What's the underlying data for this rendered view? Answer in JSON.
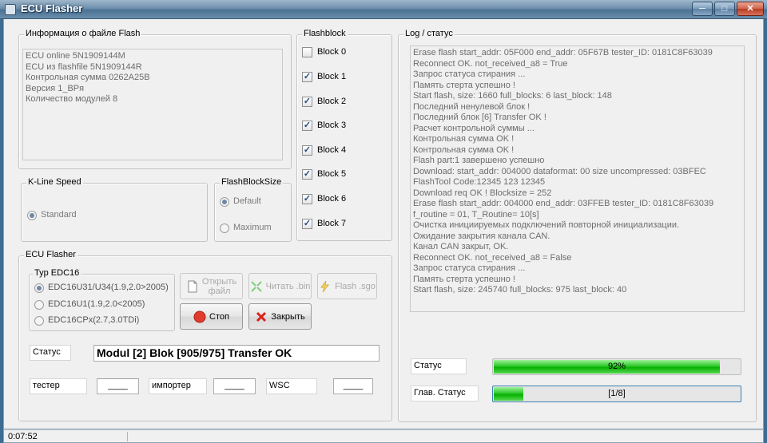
{
  "window": {
    "title": "ECU Flasher"
  },
  "file_info": {
    "legend": "Информация  о файле Flash",
    "lines": [
      "ECU online 5N1909144M",
      "ECU из flashfile 5N1909144R",
      "Контрольная сумма 0262A25B",
      "Версия 1_BPя",
      "Количество модулей 8"
    ]
  },
  "flashblock": {
    "legend": "Flashblock",
    "items": [
      {
        "label": "Block 0",
        "checked": false
      },
      {
        "label": "Block 1",
        "checked": true
      },
      {
        "label": "Block 2",
        "checked": true
      },
      {
        "label": "Block 3",
        "checked": true
      },
      {
        "label": "Block 4",
        "checked": true
      },
      {
        "label": "Block 5",
        "checked": true
      },
      {
        "label": "Block 6",
        "checked": true
      },
      {
        "label": "Block 7",
        "checked": true
      }
    ]
  },
  "kline": {
    "legend": "K-Line Speed",
    "option": "Standard"
  },
  "blocksize": {
    "legend": "FlashBlockSize",
    "default_label": "Default",
    "maximum_label": "Maximum"
  },
  "flasher": {
    "legend": "ECU Flasher",
    "edc": {
      "legend": "Typ EDC16",
      "options": [
        "EDC16U31/U34(1.9,2.0>2005)",
        "EDC16U1(1.9,2.0<2005)",
        "EDC16CPx(2.7,3.0TDi)"
      ]
    },
    "open_label": "Открыть\nфайл",
    "read_label": "Читать .bin",
    "flash_label": "Flash .sgo",
    "stop_label": "Стоп",
    "close_label": "Закрыть",
    "status_label": "Статус",
    "status_value": "Modul [2] Blok [905/975] Transfer OK",
    "tester_label": "тестер",
    "tester_value": "____",
    "importer_label": "импортер",
    "importer_value": "____",
    "wsc_label": "WSC",
    "wsc_value": "____"
  },
  "log": {
    "legend": "Log / статус",
    "lines": [
      "Erase flash start_addr: 05F000 end_addr: 05F67B tester_ID: 0181C8F63039",
      "Reconnect OK. not_received_a8 = True",
      "Запрос статуса стирания ...",
      "Память стерта успешно !",
      "Start flash, size: 1660 full_blocks: 6 last_block: 148",
      "Последний ненулевой блок !",
      "Последний блок [6] Transfer OK !",
      "Расчет контрольной суммы ...",
      "Контрольная сумма OK !",
      "Контрольная сумма OK !",
      "Flash part:1 завершено успешно",
      "Download: start_addr: 004000 dataformat: 00 size uncompressed: 03BFEC",
      "FlashTool Code:12345 123 12345",
      "Download req OK ! Blocksize = 252",
      "Erase flash start_addr: 004000 end_addr: 03FFEB tester_ID: 0181C8F63039",
      "f_routine = 01, T_Routine= 10[s]",
      "Очистка инициируемых подключений повторной инициализации.",
      "Ожидание закрытия канала CAN.",
      "Канал CAN закрыт, OK.",
      "Reconnect OK. not_received_a8 = False",
      "Запрос статуса стирания ...",
      "Память стерта успешно !",
      "Start flash, size: 245740 full_blocks: 975 last_block: 40"
    ],
    "status_label": "Статус",
    "status_progress_text": "92%",
    "status_progress": 0.92,
    "main_status_label": "Глав. Статус",
    "main_progress_text": "[1/8]",
    "main_progress": 0.125
  },
  "statusbar": {
    "time": "0:07:52"
  },
  "colors": {
    "progress_green": "#06b000",
    "title_blue": "#4c7294"
  }
}
